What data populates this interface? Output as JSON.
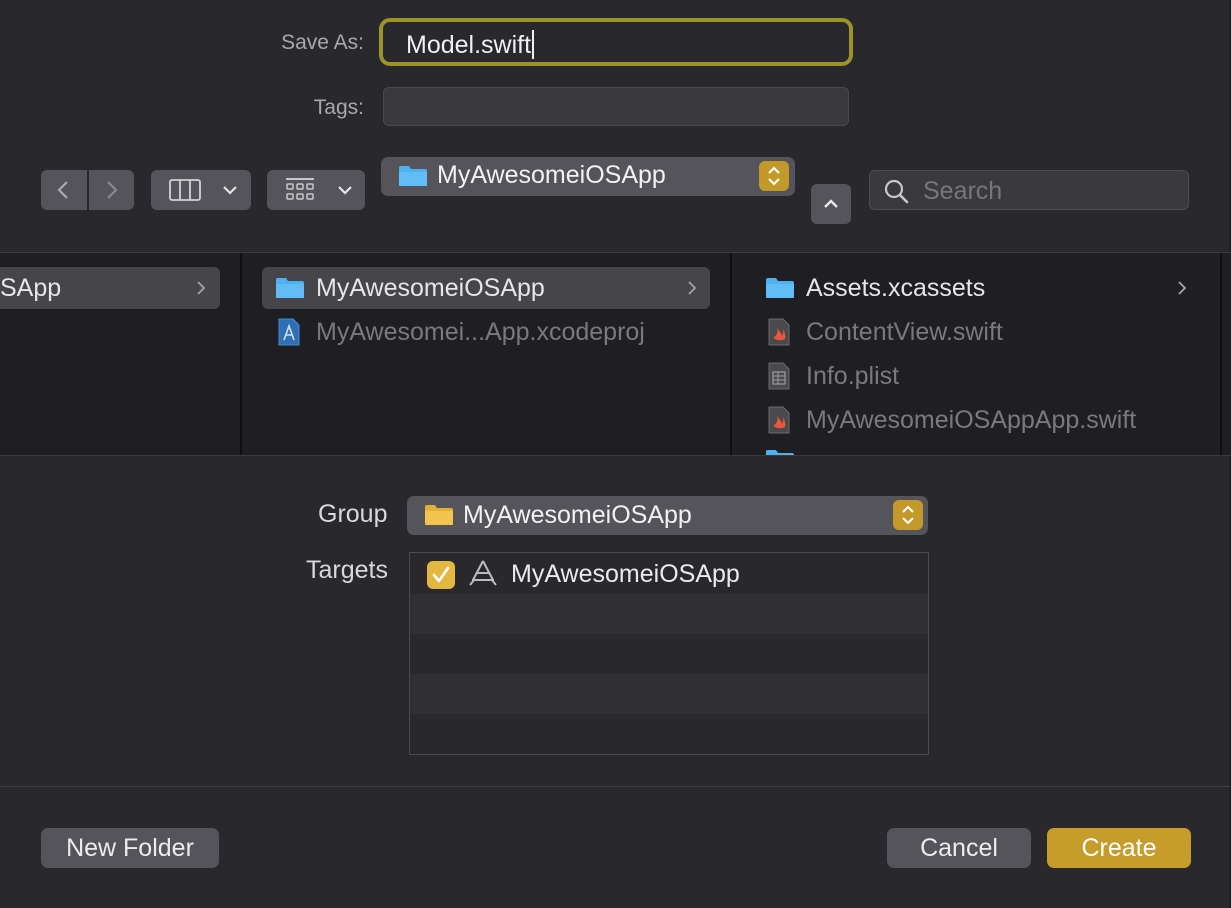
{
  "form": {
    "save_as_label": "Save As:",
    "save_as_value": "Model.swift",
    "tags_label": "Tags:",
    "tags_value": ""
  },
  "toolbar": {
    "location": "MyAwesomeiOSApp",
    "search_placeholder": "Search"
  },
  "browser": {
    "column1": [
      {
        "label": "SApp",
        "selected": true,
        "has_children": true
      }
    ],
    "column2": [
      {
        "label": "MyAwesomeiOSApp",
        "kind": "folder",
        "selected": true,
        "has_children": true
      },
      {
        "label": "MyAwesomei...App.xcodeproj",
        "kind": "xcodeproj",
        "dimmed": true
      }
    ],
    "column3": [
      {
        "label": "Assets.xcassets",
        "kind": "folder",
        "has_children": true
      },
      {
        "label": "ContentView.swift",
        "kind": "swift",
        "dimmed": true
      },
      {
        "label": "Info.plist",
        "kind": "plist",
        "dimmed": true
      },
      {
        "label": "MyAwesomeiOSAppApp.swift",
        "kind": "swift",
        "dimmed": true
      }
    ]
  },
  "options": {
    "group_label": "Group",
    "group_value": "MyAwesomeiOSApp",
    "targets_label": "Targets",
    "targets": [
      {
        "label": "MyAwesomeiOSApp",
        "checked": true
      }
    ]
  },
  "footer": {
    "new_folder": "New Folder",
    "cancel": "Cancel",
    "create": "Create"
  },
  "colors": {
    "accent": "#c69c2b",
    "focus_ring": "#9b9427",
    "folder_blue": "#4fb1f0",
    "folder_yellow": "#f3c54f"
  },
  "icons": [
    "chevron-left-icon",
    "chevron-right-icon",
    "columns-view-icon",
    "chevron-down-icon",
    "grid-view-icon",
    "folder-icon",
    "stepper-icon",
    "chevron-up-icon",
    "search-icon",
    "xcodeproj-icon",
    "swift-file-icon",
    "plist-file-icon",
    "app-target-icon",
    "checkmark-icon"
  ]
}
